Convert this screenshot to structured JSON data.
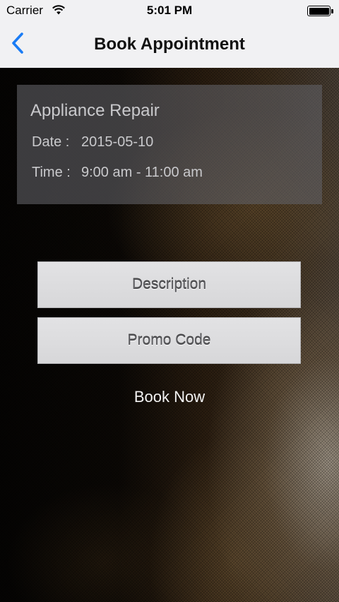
{
  "status_bar": {
    "carrier": "Carrier",
    "time": "5:01 PM",
    "wifi_icon": "wifi-icon",
    "battery_icon": "battery-icon"
  },
  "nav": {
    "title": "Book Appointment",
    "back_icon": "chevron-left-icon",
    "accent_color": "#1a7cf5"
  },
  "appointment": {
    "service": "Appliance Repair",
    "date_label": "Date :",
    "date_value": "2015-05-10",
    "time_label": "Time :",
    "time_value": "9:00 am - 11:00 am"
  },
  "actions": {
    "description_label": "Description",
    "promo_label": "Promo Code",
    "book_label": "Book Now"
  }
}
